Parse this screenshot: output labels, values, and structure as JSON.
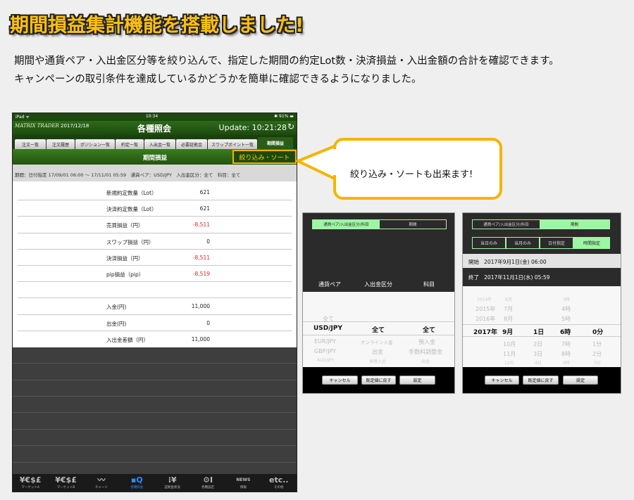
{
  "headline": "期間損益集計機能を搭載しました!",
  "description": [
    "期間や通貨ペア・入出金区分等を絞り込んで、指定した期間の約定Lot数・決済損益・入出金額の合計を確認できます。",
    "キャンペーンの取引条件を達成しているかどうかを簡単に確認できるようになりました。"
  ],
  "ipad": {
    "status": {
      "left": "iPad ᯤ",
      "center": "10:34",
      "right": "✱ 91% ▬"
    },
    "logo": "MATRIX TRADER",
    "date": "2017/12/18",
    "title": "各種照会",
    "update": "Update: 10:21:28",
    "tabs": [
      "注文一覧",
      "注文履歴",
      "ポジション一覧",
      "約定一覧",
      "入出金一覧",
      "必要証拠金",
      "スワップポイント一覧",
      "期間損益"
    ],
    "section_title": "期間損益",
    "filter_button": "絞り込み・ソート",
    "conditions": "期間：日付指定 17/09/01 06:00 ～ 17/11/01 05:59　通貨ペア：USD/JPY　入出金区分：全て　科目：全て",
    "rows": [
      {
        "label": "新規約定数量（Lot）",
        "value": "621",
        "neg": false
      },
      {
        "label": "決済約定数量（Lot）",
        "value": "621",
        "neg": false
      },
      {
        "label": "売買損益（円）",
        "value": "-8,511",
        "neg": true
      },
      {
        "label": "スワップ損益（円）",
        "value": "0",
        "neg": false
      },
      {
        "label": "決済損益（円）",
        "value": "-8,511",
        "neg": true
      },
      {
        "label": "pip損益（pip）",
        "value": "-8,519",
        "neg": true
      },
      {
        "label": "",
        "value": "",
        "neg": false
      },
      {
        "label": "入金(円)",
        "value": "11,000",
        "neg": false
      },
      {
        "label": "出金(円)",
        "value": "0",
        "neg": false
      },
      {
        "label": "入出金差額（円）",
        "value": "11,000",
        "neg": false
      }
    ],
    "nav": [
      {
        "icon": "¥€$£",
        "label": "マーケットA"
      },
      {
        "icon": "¥€$£",
        "label": "マーケットB"
      },
      {
        "icon": "〰",
        "label": "チャート"
      },
      {
        "icon": "▪Q",
        "label": "各種照会"
      },
      {
        "icon": "⁝¥",
        "label": "証拠金状況"
      },
      {
        "icon": "⚙I",
        "label": "各種設定"
      },
      {
        "icon": "NEWS",
        "label": "情報"
      },
      {
        "icon": "etc..",
        "label": "その他"
      }
    ]
  },
  "callout": "絞り込み・ソートも出来ます!",
  "shot1": {
    "seg": [
      "通貨ペア/入出金区分/科目",
      "期間"
    ],
    "cols": [
      "通貨ペア",
      "入出金区分",
      "科目"
    ],
    "col1": [
      "全て",
      "USD/JPY",
      "EUR/JPY",
      "GBP/JPY",
      "AUD/JPY"
    ],
    "col2": [
      "全て",
      "オンライン入金",
      "出金",
      "振替入金"
    ],
    "col3": [
      "全て",
      "預入金",
      "手数料調整金",
      "出金"
    ],
    "buttons": [
      "キャンセル",
      "既定値に戻す",
      "設定"
    ]
  },
  "shot2": {
    "seg": [
      "通貨ペア/入出金区分/科目",
      "期間"
    ],
    "quick": [
      "当日のみ",
      "当月のみ",
      "日付指定",
      "時間指定"
    ],
    "start_label": "開始",
    "start_value": "2017年9月1日(金) 06:00",
    "end_label": "終了",
    "end_value": "2017年11月1日(水) 05:59",
    "years": [
      "2014年",
      "2015年",
      "2016年",
      "2017年"
    ],
    "months": [
      "6月",
      "7月",
      "8月",
      "9月",
      "10月",
      "11月",
      "12月"
    ],
    "days": [
      "1日",
      "2日",
      "3日",
      "4日"
    ],
    "hours": [
      "3時",
      "4時",
      "5時",
      "6時",
      "7時",
      "8時",
      "9時"
    ],
    "minutes": [
      "0分",
      "1分",
      "2分",
      "3分"
    ],
    "buttons": [
      "キャンセル",
      "既定値に戻す",
      "設定"
    ]
  }
}
